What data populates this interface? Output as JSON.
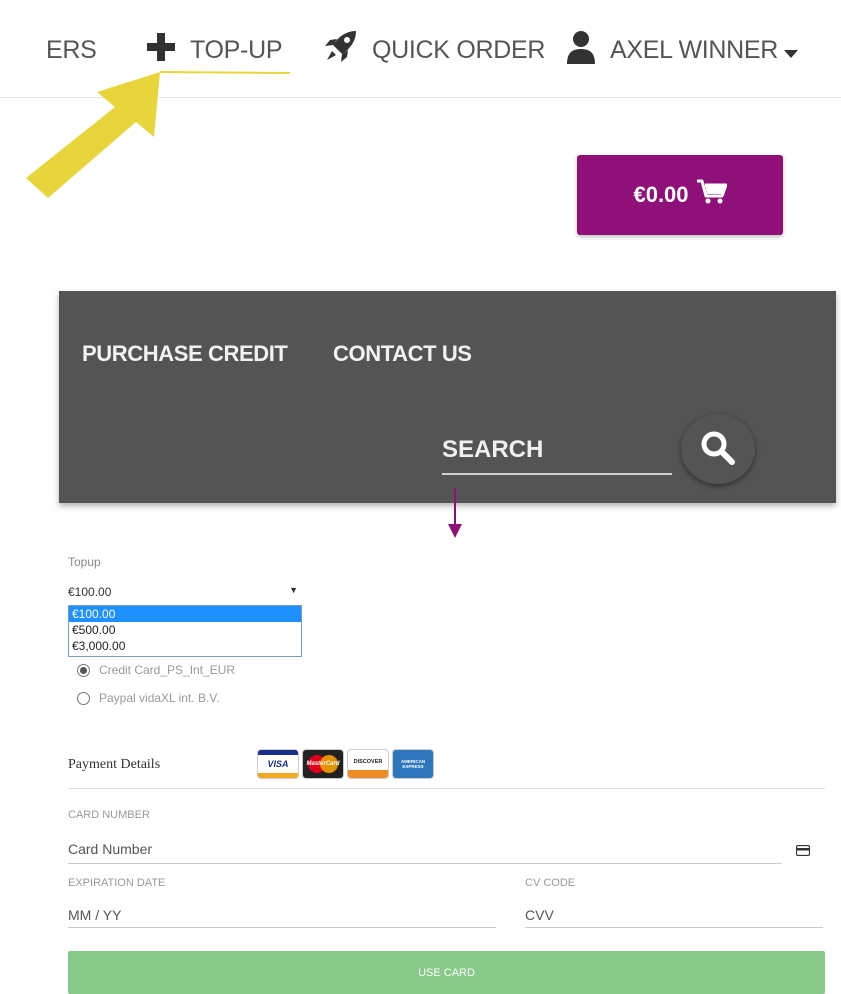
{
  "nav": {
    "orders_label": "ERS",
    "topup_label": "TOP-UP",
    "quick_order_label": "QUICK ORDER",
    "user_label": "AXEL WINNER"
  },
  "cart": {
    "total": "€0.00",
    "accent_color": "#8e1078"
  },
  "menu": {
    "purchase_credit": "PURCHASE CREDIT",
    "contact_us": "CONTACT US",
    "search_placeholder": "SEARCH"
  },
  "topup": {
    "label": "Topup",
    "selected_value": "€100.00",
    "options": [
      "€100.00",
      "€500.00",
      "€3,000.00"
    ]
  },
  "payment_methods": [
    {
      "label": "Credit Card_PS_Int_EUR",
      "checked": true
    },
    {
      "label": "Paypal vidaXL int. B.V.",
      "checked": false
    }
  ],
  "payment_details": {
    "title": "Payment Details",
    "card_logos": [
      "VISA",
      "MasterCard",
      "DISCOVER",
      "AMERICAN EXPRESS"
    ]
  },
  "card_form": {
    "card_number_label": "CARD NUMBER",
    "card_number_placeholder": "Card Number",
    "expiration_label": "EXPIRATION DATE",
    "expiration_placeholder": "MM / YY",
    "cv_label": "CV CODE",
    "cv_placeholder": "CVV",
    "submit_label": "USE CARD",
    "submit_color": "#88c98a"
  },
  "icons": {
    "topup": "plus-icon",
    "quick_order": "rocket-icon",
    "user": "user-icon",
    "cart": "cart-icon",
    "search": "search-icon",
    "card": "credit-card-icon"
  }
}
